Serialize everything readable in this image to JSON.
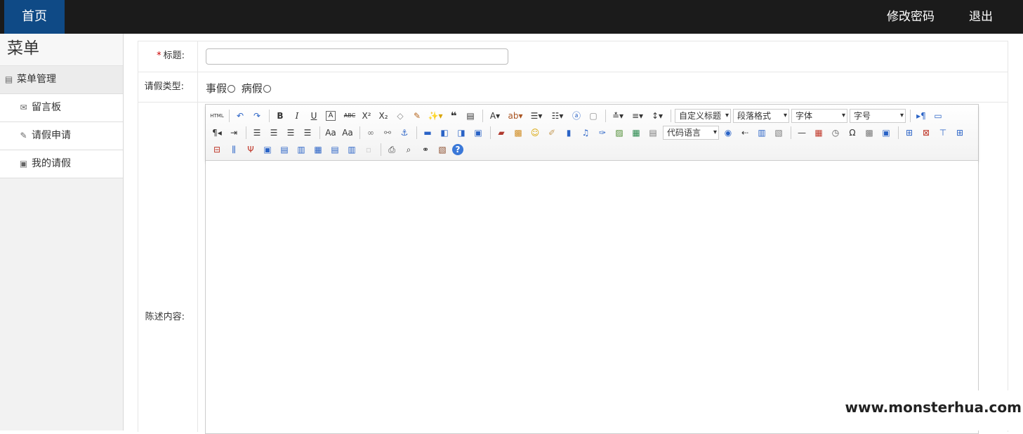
{
  "topbar": {
    "home_label": "首页",
    "change_password_label": "修改密码",
    "logout_label": "退出"
  },
  "sidebar": {
    "title": "菜单",
    "group_label": "菜单管理",
    "items": [
      {
        "label": "留言板",
        "icon": "envelope-icon"
      },
      {
        "label": "请假申请",
        "icon": "pen-icon"
      },
      {
        "label": "我的请假",
        "icon": "image-icon"
      }
    ]
  },
  "form": {
    "title_required_mark": "*",
    "title_label": "标题:",
    "title_value": "",
    "leave_type_label": "请假类型:",
    "leave_options": [
      "事假",
      "病假"
    ],
    "content_label": "陈述内容:"
  },
  "editor": {
    "custom_heading": "自定义标题",
    "paragraph_format": "段落格式",
    "font_family": "字体",
    "font_size": "字号",
    "code_language": "代码语言"
  },
  "watermark": "www.monsterhua.com",
  "colors": {
    "topbar": "#1b1b1b",
    "home_active": "#0f4a86",
    "required": "#cc0000"
  }
}
